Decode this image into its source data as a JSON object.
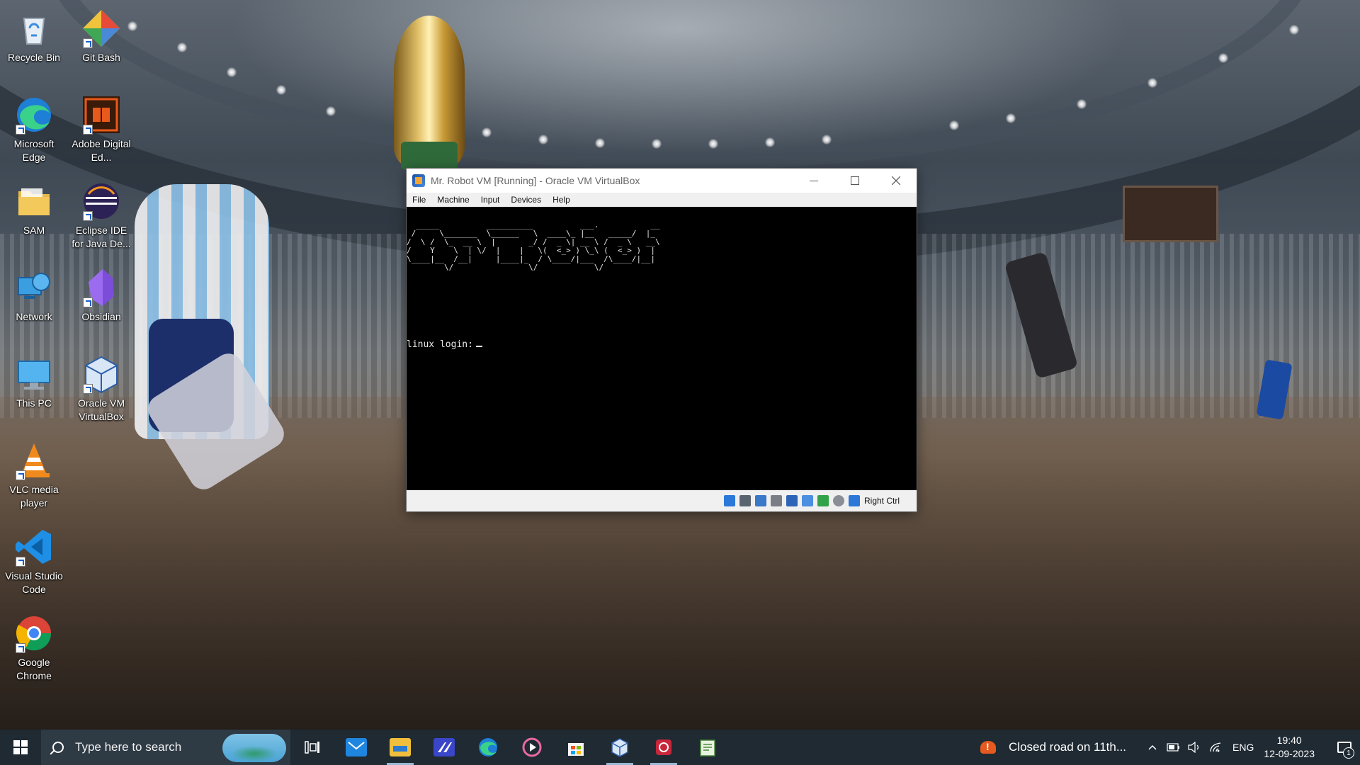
{
  "desktop": {
    "icons": [
      {
        "label": "Recycle Bin",
        "icon": "recycle-bin-icon"
      },
      {
        "label": "Git Bash",
        "icon": "git-bash-icon"
      },
      {
        "label": "Microsoft Edge",
        "icon": "edge-icon"
      },
      {
        "label": "Adobe Digital Ed...",
        "icon": "adobe-digital-editions-icon"
      },
      {
        "label": "SAM",
        "icon": "folder-icon"
      },
      {
        "label": "Eclipse IDE for Java De...",
        "icon": "eclipse-icon"
      },
      {
        "label": "Network",
        "icon": "network-icon"
      },
      {
        "label": "Obsidian",
        "icon": "obsidian-icon"
      },
      {
        "label": "This PC",
        "icon": "this-pc-icon"
      },
      {
        "label": "Oracle VM VirtualBox",
        "icon": "virtualbox-icon"
      },
      {
        "label": "VLC media player",
        "icon": "vlc-icon"
      },
      {
        "label": "Visual Studio Code",
        "icon": "vscode-icon"
      },
      {
        "label": "Google Chrome",
        "icon": "chrome-icon"
      }
    ]
  },
  "vbox": {
    "title": "Mr. Robot VM [Running] - Oracle VM VirtualBox",
    "menu": [
      "File",
      "Machine",
      "Input",
      "Devices",
      "Help"
    ],
    "ascii_art": "  _____          __________          ___.           __   \n /     \\_______  \\______   \\  ____\\_ |__   _____/  |_ \n/  \\ /  \\_  __ \\  |       _/ /  _ \\| __ \\ /  _ \\   __\\\n/    Y    \\  | \\/  |    |   \\(  <_> ) \\_\\ (  <_> )  |  \n\\____|__  /__|     |____|_  / \\____/|___  /\\____/|__|  \n        \\/                \\/            \\/             ",
    "login_prompt": "linux login:",
    "host_key": "Right Ctrl"
  },
  "taskbar": {
    "search_placeholder": "Type here to search",
    "apps": [
      "task-view-icon",
      "mail-icon",
      "file-explorer-icon",
      "vmware-icon",
      "edge-icon",
      "media-player-icon",
      "microsoft-store-icon",
      "virtualbox-icon",
      "app-icon",
      "notepad-icon"
    ],
    "news": "Closed road on 11th...",
    "language": "ENG",
    "time": "19:40",
    "date": "12-09-2023",
    "notification_count": "1"
  },
  "colors": {
    "taskbar": "#1f2a33",
    "terminal_bg": "#000000",
    "terminal_fg": "#e6e6e6"
  }
}
